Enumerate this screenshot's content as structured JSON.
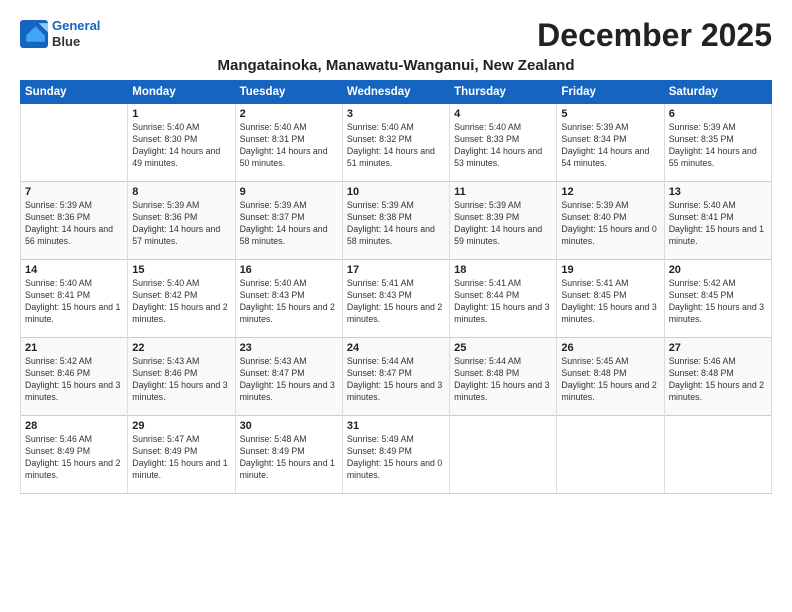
{
  "logo": {
    "line1": "General",
    "line2": "Blue"
  },
  "title": "December 2025",
  "subtitle": "Mangatainoka, Manawatu-Wanganui, New Zealand",
  "days_of_week": [
    "Sunday",
    "Monday",
    "Tuesday",
    "Wednesday",
    "Thursday",
    "Friday",
    "Saturday"
  ],
  "weeks": [
    [
      {
        "day": "",
        "info": ""
      },
      {
        "day": "1",
        "info": "Sunrise: 5:40 AM\nSunset: 8:30 PM\nDaylight: 14 hours\nand 49 minutes."
      },
      {
        "day": "2",
        "info": "Sunrise: 5:40 AM\nSunset: 8:31 PM\nDaylight: 14 hours\nand 50 minutes."
      },
      {
        "day": "3",
        "info": "Sunrise: 5:40 AM\nSunset: 8:32 PM\nDaylight: 14 hours\nand 51 minutes."
      },
      {
        "day": "4",
        "info": "Sunrise: 5:40 AM\nSunset: 8:33 PM\nDaylight: 14 hours\nand 53 minutes."
      },
      {
        "day": "5",
        "info": "Sunrise: 5:39 AM\nSunset: 8:34 PM\nDaylight: 14 hours\nand 54 minutes."
      },
      {
        "day": "6",
        "info": "Sunrise: 5:39 AM\nSunset: 8:35 PM\nDaylight: 14 hours\nand 55 minutes."
      }
    ],
    [
      {
        "day": "7",
        "info": "Sunrise: 5:39 AM\nSunset: 8:36 PM\nDaylight: 14 hours\nand 56 minutes."
      },
      {
        "day": "8",
        "info": "Sunrise: 5:39 AM\nSunset: 8:36 PM\nDaylight: 14 hours\nand 57 minutes."
      },
      {
        "day": "9",
        "info": "Sunrise: 5:39 AM\nSunset: 8:37 PM\nDaylight: 14 hours\nand 58 minutes."
      },
      {
        "day": "10",
        "info": "Sunrise: 5:39 AM\nSunset: 8:38 PM\nDaylight: 14 hours\nand 58 minutes."
      },
      {
        "day": "11",
        "info": "Sunrise: 5:39 AM\nSunset: 8:39 PM\nDaylight: 14 hours\nand 59 minutes."
      },
      {
        "day": "12",
        "info": "Sunrise: 5:39 AM\nSunset: 8:40 PM\nDaylight: 15 hours\nand 0 minutes."
      },
      {
        "day": "13",
        "info": "Sunrise: 5:40 AM\nSunset: 8:41 PM\nDaylight: 15 hours\nand 1 minute."
      }
    ],
    [
      {
        "day": "14",
        "info": "Sunrise: 5:40 AM\nSunset: 8:41 PM\nDaylight: 15 hours\nand 1 minute."
      },
      {
        "day": "15",
        "info": "Sunrise: 5:40 AM\nSunset: 8:42 PM\nDaylight: 15 hours\nand 2 minutes."
      },
      {
        "day": "16",
        "info": "Sunrise: 5:40 AM\nSunset: 8:43 PM\nDaylight: 15 hours\nand 2 minutes."
      },
      {
        "day": "17",
        "info": "Sunrise: 5:41 AM\nSunset: 8:43 PM\nDaylight: 15 hours\nand 2 minutes."
      },
      {
        "day": "18",
        "info": "Sunrise: 5:41 AM\nSunset: 8:44 PM\nDaylight: 15 hours\nand 3 minutes."
      },
      {
        "day": "19",
        "info": "Sunrise: 5:41 AM\nSunset: 8:45 PM\nDaylight: 15 hours\nand 3 minutes."
      },
      {
        "day": "20",
        "info": "Sunrise: 5:42 AM\nSunset: 8:45 PM\nDaylight: 15 hours\nand 3 minutes."
      }
    ],
    [
      {
        "day": "21",
        "info": "Sunrise: 5:42 AM\nSunset: 8:46 PM\nDaylight: 15 hours\nand 3 minutes."
      },
      {
        "day": "22",
        "info": "Sunrise: 5:43 AM\nSunset: 8:46 PM\nDaylight: 15 hours\nand 3 minutes."
      },
      {
        "day": "23",
        "info": "Sunrise: 5:43 AM\nSunset: 8:47 PM\nDaylight: 15 hours\nand 3 minutes."
      },
      {
        "day": "24",
        "info": "Sunrise: 5:44 AM\nSunset: 8:47 PM\nDaylight: 15 hours\nand 3 minutes."
      },
      {
        "day": "25",
        "info": "Sunrise: 5:44 AM\nSunset: 8:48 PM\nDaylight: 15 hours\nand 3 minutes."
      },
      {
        "day": "26",
        "info": "Sunrise: 5:45 AM\nSunset: 8:48 PM\nDaylight: 15 hours\nand 2 minutes."
      },
      {
        "day": "27",
        "info": "Sunrise: 5:46 AM\nSunset: 8:48 PM\nDaylight: 15 hours\nand 2 minutes."
      }
    ],
    [
      {
        "day": "28",
        "info": "Sunrise: 5:46 AM\nSunset: 8:49 PM\nDaylight: 15 hours\nand 2 minutes."
      },
      {
        "day": "29",
        "info": "Sunrise: 5:47 AM\nSunset: 8:49 PM\nDaylight: 15 hours\nand 1 minute."
      },
      {
        "day": "30",
        "info": "Sunrise: 5:48 AM\nSunset: 8:49 PM\nDaylight: 15 hours\nand 1 minute."
      },
      {
        "day": "31",
        "info": "Sunrise: 5:49 AM\nSunset: 8:49 PM\nDaylight: 15 hours\nand 0 minutes."
      },
      {
        "day": "",
        "info": ""
      },
      {
        "day": "",
        "info": ""
      },
      {
        "day": "",
        "info": ""
      }
    ]
  ]
}
